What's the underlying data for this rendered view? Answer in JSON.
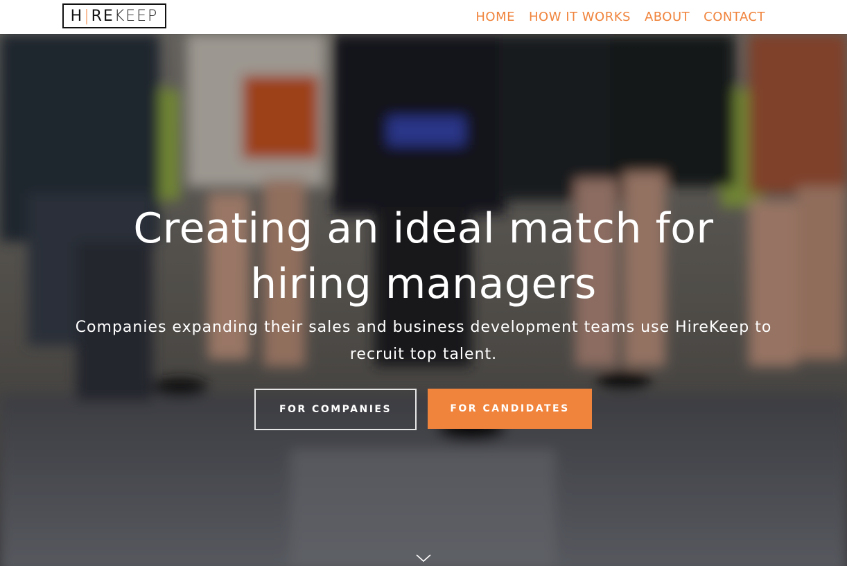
{
  "brand": {
    "logo_left": "H",
    "logo_bar": "|",
    "logo_mid": "RE",
    "logo_right": "KEEP",
    "accent_color": "#f0843d"
  },
  "nav": {
    "items": [
      {
        "label": "HOME"
      },
      {
        "label": "HOW IT WORKS"
      },
      {
        "label": "ABOUT"
      },
      {
        "label": "CONTACT"
      }
    ]
  },
  "hero": {
    "title_line1": "Creating an ideal match for",
    "title_line2": "hiring managers",
    "subtitle": "Companies expanding their sales and business development teams use HireKeep to recruit top talent.",
    "buttons": {
      "companies": "FOR COMPANIES",
      "candidates": "FOR CANDIDATES"
    },
    "scroll_icon": "chevron-down-icon"
  }
}
